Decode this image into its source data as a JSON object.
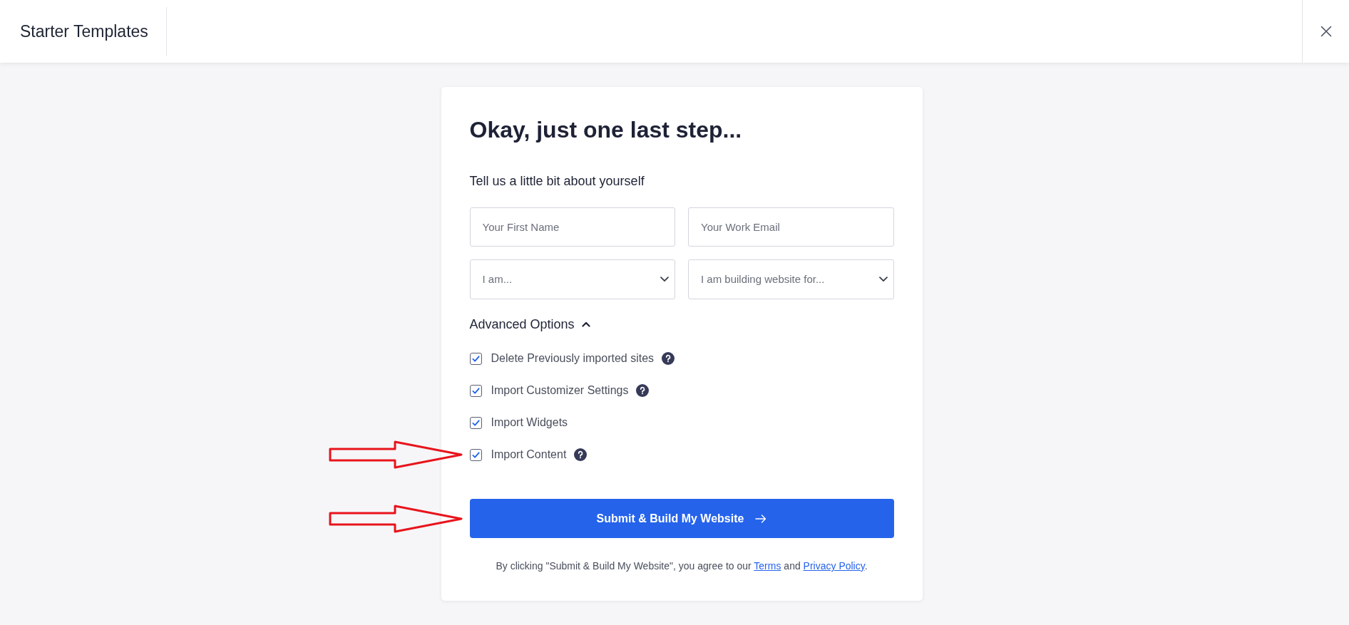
{
  "header": {
    "title": "Starter Templates"
  },
  "form": {
    "title": "Okay, just one last step...",
    "subtitle": "Tell us a little bit about yourself",
    "fields": [
      {
        "kind": "text",
        "placeholder": "Your First Name"
      },
      {
        "kind": "text",
        "placeholder": "Your Work Email"
      },
      {
        "kind": "select",
        "placeholder": "I am..."
      },
      {
        "kind": "select",
        "placeholder": "I am building website for..."
      }
    ],
    "advanced_options": {
      "label": "Advanced Options",
      "expanded": true
    },
    "options": [
      {
        "label": "Delete Previously imported sites",
        "checked": true,
        "help": true,
        "arrow_marker": false
      },
      {
        "label": "Import Customizer Settings",
        "checked": true,
        "help": true,
        "arrow_marker": false
      },
      {
        "label": "Import Widgets",
        "checked": true,
        "help": false,
        "arrow_marker": false
      },
      {
        "label": "Import Content",
        "checked": true,
        "help": true,
        "arrow_marker": true
      }
    ],
    "submit": {
      "label": "Submit & Build My Website",
      "arrow_marker": true
    },
    "agreement": {
      "text": "By clicking \"Submit & Build My Website\", you agree to our",
      "terms_link": "Terms",
      "joiner": "and",
      "privacy_link": "Privacy Policy",
      "end": "."
    }
  }
}
